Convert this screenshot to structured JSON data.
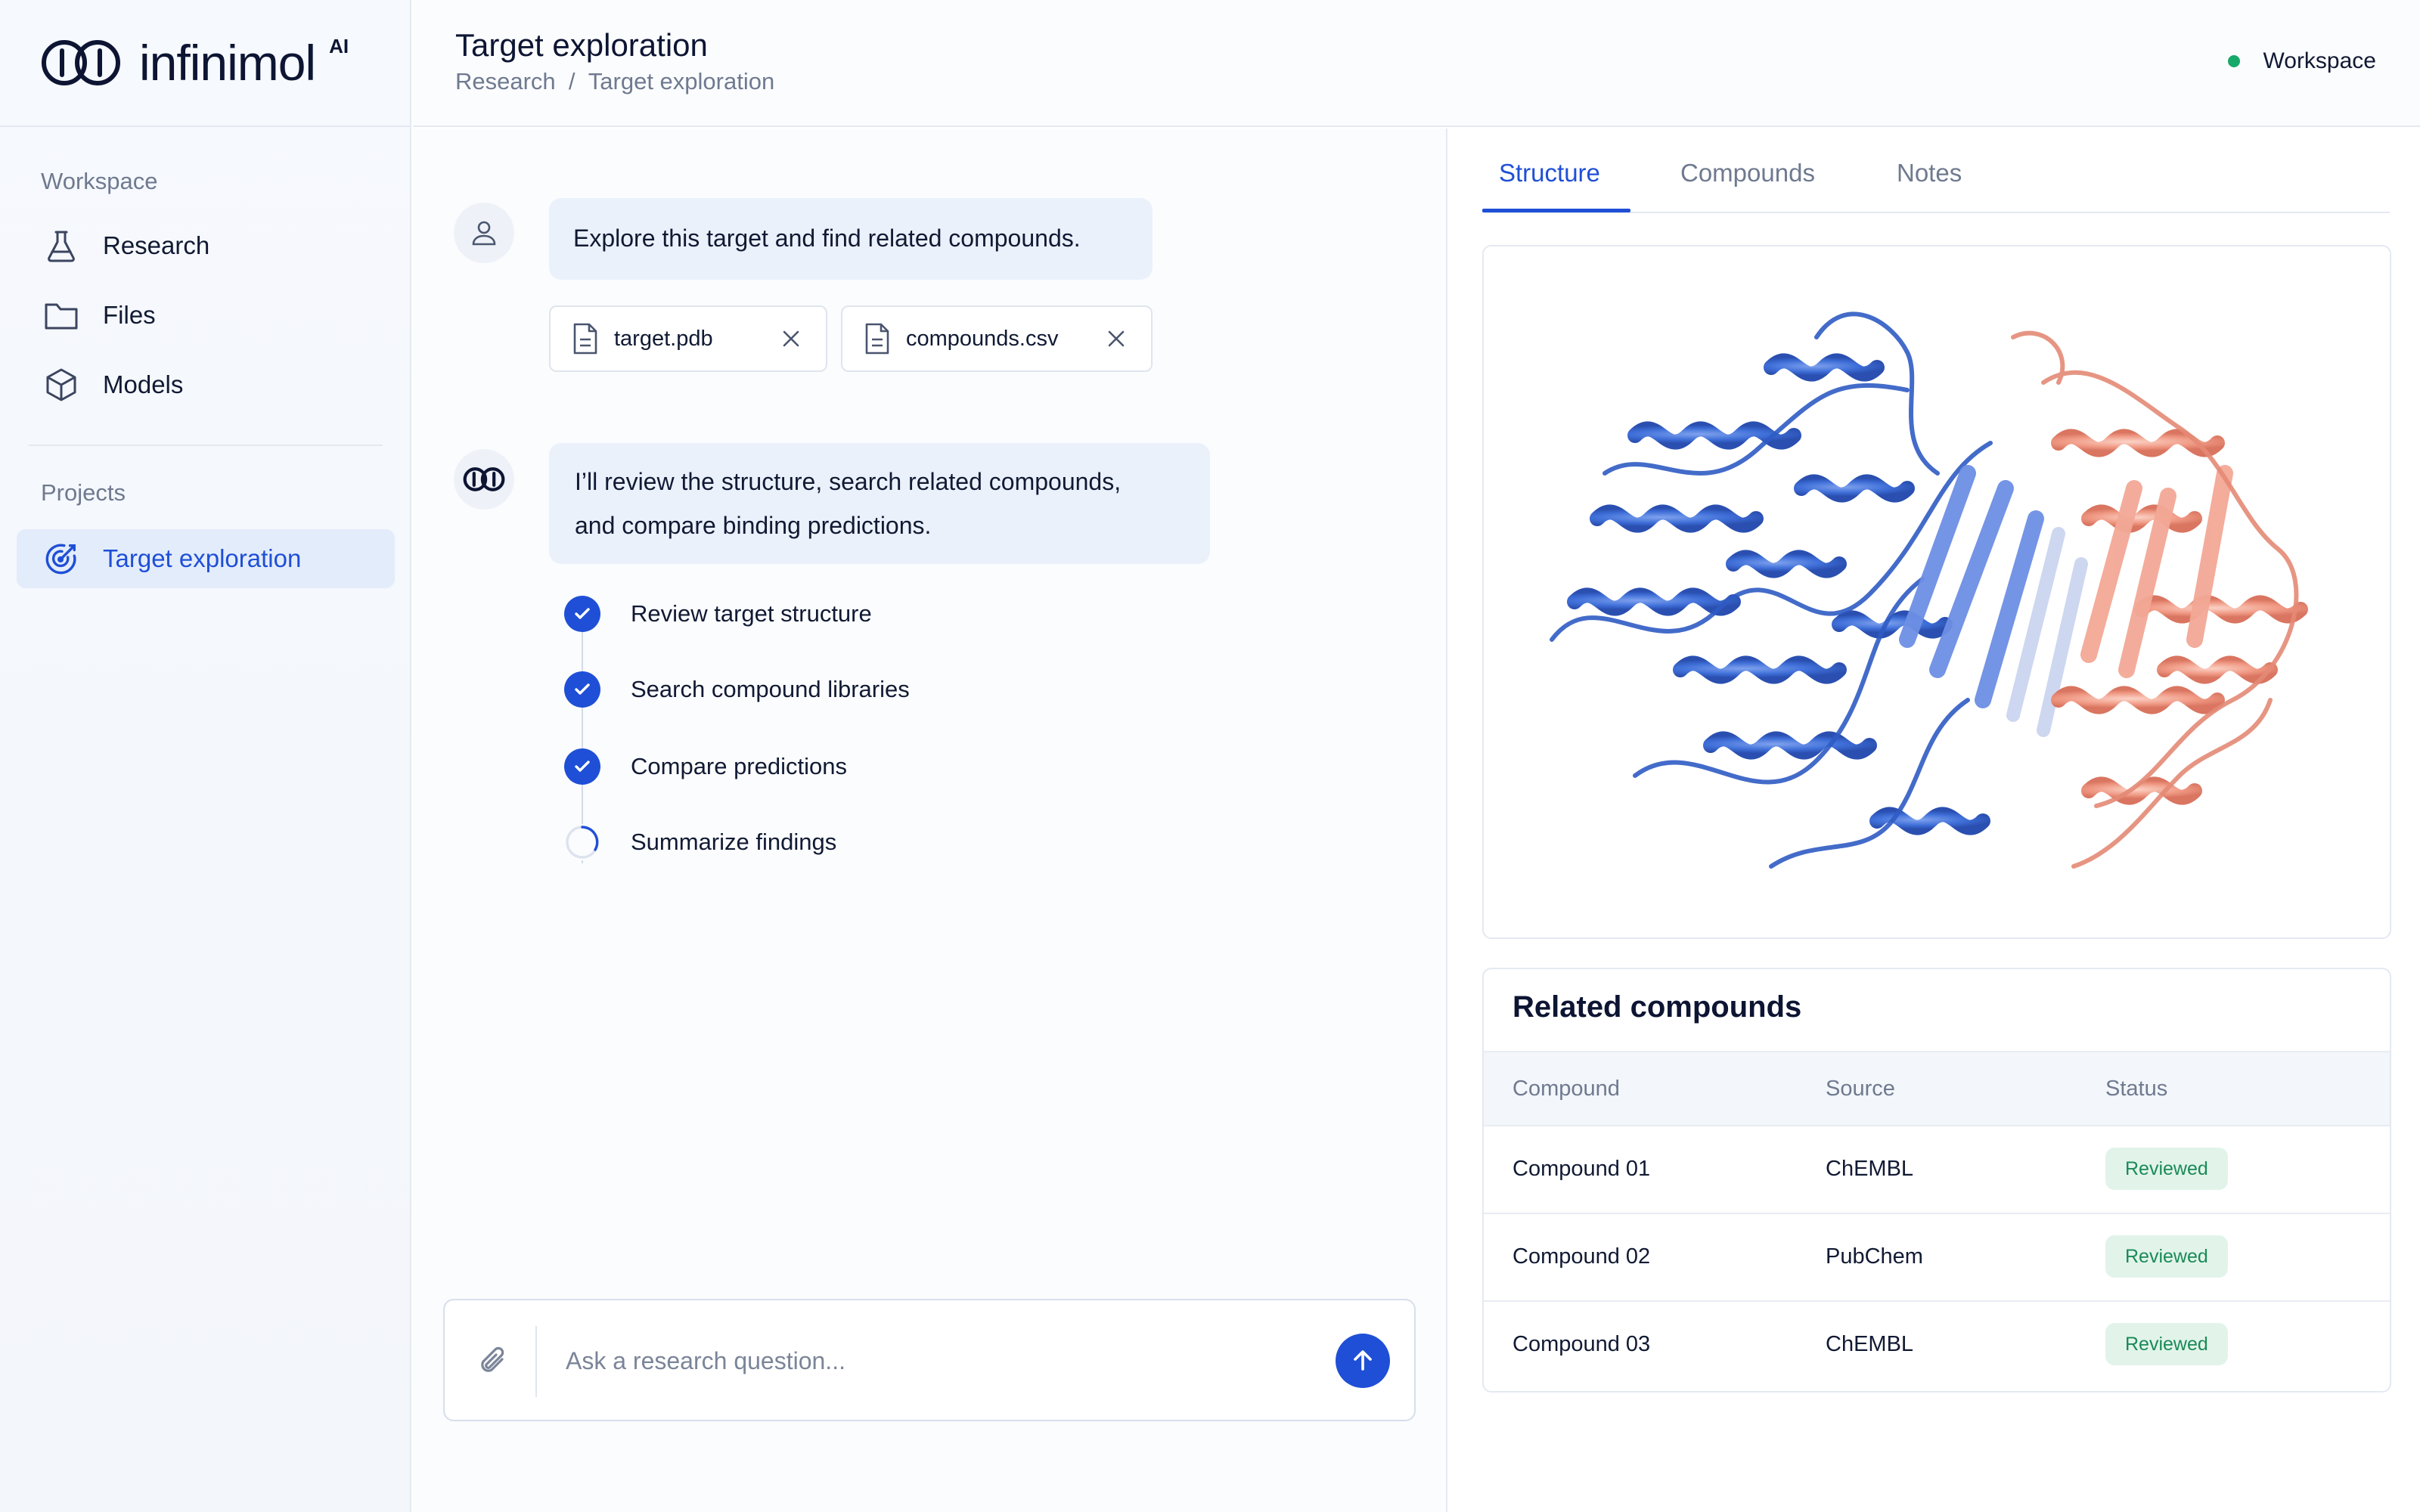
{
  "brand": {
    "name": "infinimol",
    "suffix": "AI"
  },
  "sidebar": {
    "workspace_heading": "Workspace",
    "items": [
      {
        "label": "Research",
        "icon": "flask-icon"
      },
      {
        "label": "Files",
        "icon": "folder-icon"
      },
      {
        "label": "Models",
        "icon": "cube-icon"
      }
    ],
    "projects_heading": "Projects",
    "projects": [
      {
        "label": "Target exploration",
        "icon": "target-icon",
        "active": true
      }
    ]
  },
  "header": {
    "title": "Target exploration",
    "breadcrumb": [
      "Research",
      "/",
      "Target exploration"
    ],
    "workspace_status": {
      "label": "Workspace",
      "color": "#17a86a"
    }
  },
  "chat": {
    "user_message": "Explore this target and find related compounds.",
    "attachments": [
      {
        "name": "target.pdb",
        "icon": "file-icon"
      },
      {
        "name": "compounds.csv",
        "icon": "file-icon"
      }
    ],
    "assistant_message_line1": "I’ll review the structure, search related compounds,",
    "assistant_message_line2": "and compare binding predictions.",
    "steps": [
      {
        "label": "Review target structure",
        "status": "done"
      },
      {
        "label": "Search compound libraries",
        "status": "done"
      },
      {
        "label": "Compare predictions",
        "status": "done"
      },
      {
        "label": "Summarize findings",
        "status": "in-progress"
      }
    ],
    "composer": {
      "placeholder": "Ask a research question..."
    }
  },
  "panel": {
    "tabs": [
      {
        "label": "Structure",
        "active": true
      },
      {
        "label": "Compounds",
        "active": false
      },
      {
        "label": "Notes",
        "active": false
      }
    ],
    "related": {
      "title": "Related compounds",
      "columns": [
        "Compound",
        "Source",
        "Status"
      ],
      "rows": [
        {
          "compound": "Compound 01",
          "source": "ChEMBL",
          "status": "Reviewed"
        },
        {
          "compound": "Compound 02",
          "source": "PubChem",
          "status": "Reviewed"
        },
        {
          "compound": "Compound 03",
          "source": "ChEMBL",
          "status": "Reviewed"
        }
      ]
    }
  },
  "colors": {
    "accent": "#1f4fd6",
    "protein_chain_a": "#3f6fd8",
    "protein_chain_b": "#f0a190",
    "status_reviewed_bg": "#e2f4ea",
    "status_reviewed_text": "#1a8a57"
  }
}
